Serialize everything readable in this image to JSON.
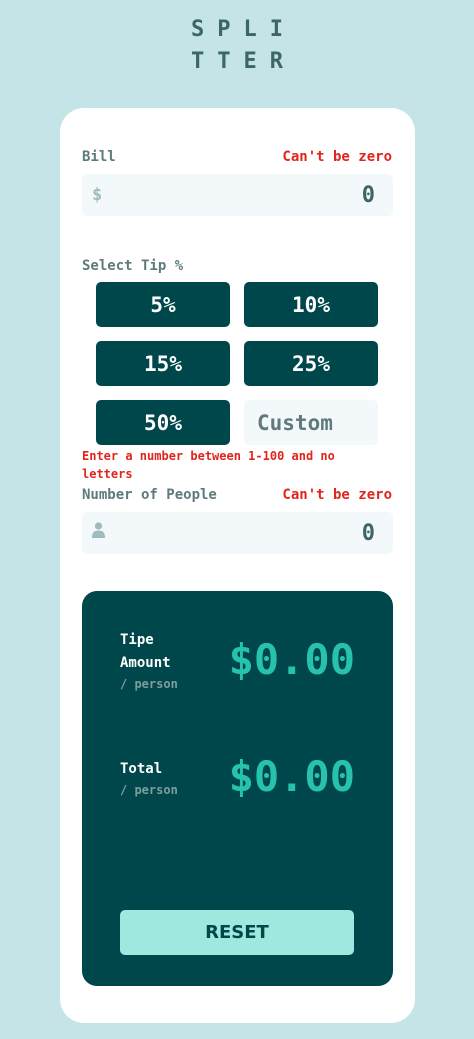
{
  "logo": {
    "line1": "SPLI",
    "line2": "TTER"
  },
  "bill": {
    "label": "Bill",
    "error": "Can't be zero",
    "icon": "dollar-icon",
    "icon_glyph": "$",
    "value": "0"
  },
  "tip": {
    "label": "Select Tip %",
    "options": [
      "5%",
      "10%",
      "15%",
      "25%",
      "50%"
    ],
    "custom_placeholder": "Custom",
    "error": "Enter a number between 1-100 and no letters"
  },
  "people": {
    "label": "Number of People",
    "error": "Can't be zero",
    "icon": "person-icon",
    "value": "0"
  },
  "result": {
    "tip_label_1": "Tipe",
    "tip_label_2": "Amount",
    "tip_sub": "/ person",
    "tip_amount": "$0.00",
    "total_label": "Total",
    "total_sub": "/ person",
    "total_amount": "$0.00",
    "reset_label": "RESET"
  },
  "colors": {
    "background": "#c5e4e7",
    "primary": "#00474b",
    "accent": "#26c2ad",
    "error": "#e0251b",
    "reset_bg": "#9fe8df"
  }
}
